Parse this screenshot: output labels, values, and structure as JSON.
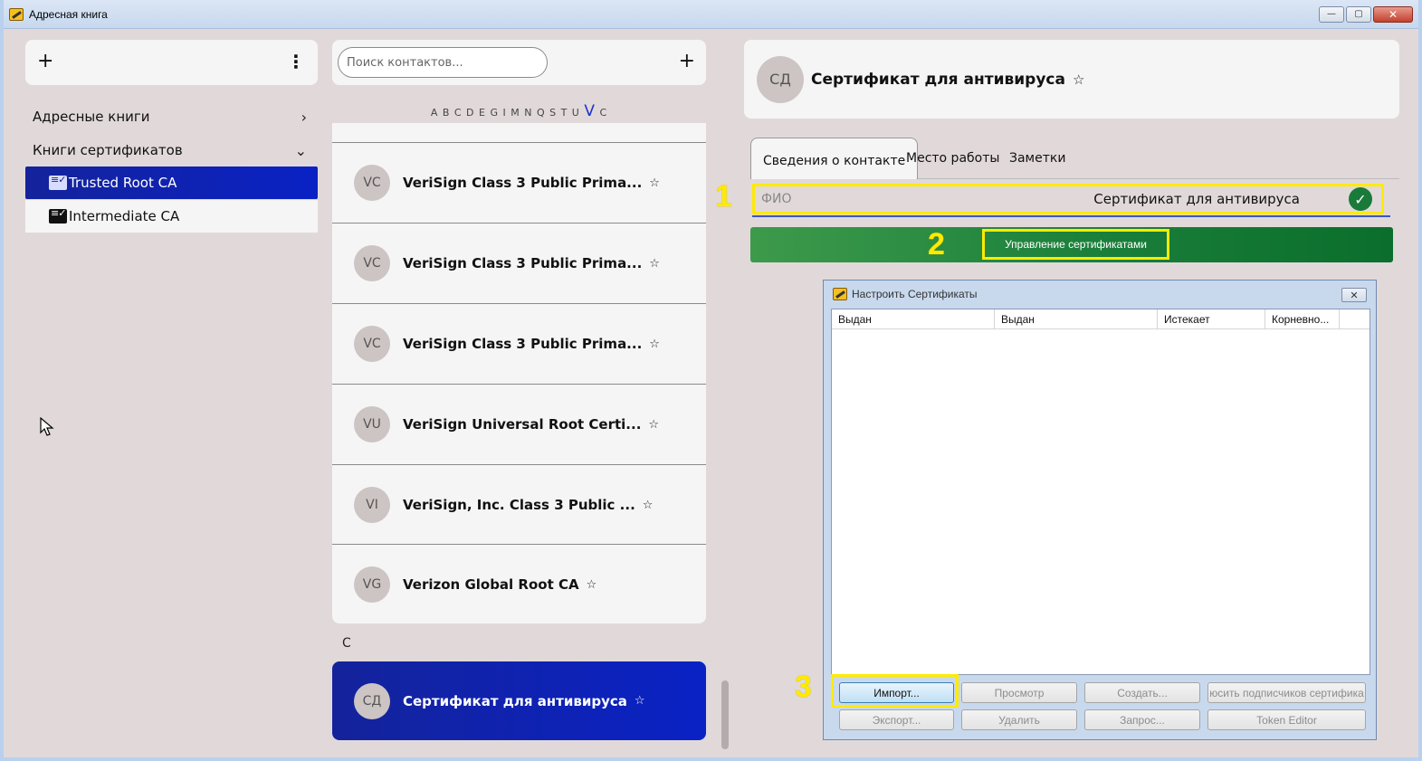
{
  "window": {
    "title": "Адресная книга",
    "min": "—",
    "max": "▢",
    "close": "✕"
  },
  "left": {
    "add": "+",
    "menu": "⋮",
    "nav": [
      {
        "label": "Адресные книги",
        "chevron": "›"
      },
      {
        "label": "Книги сертификатов",
        "chevron": "⌄"
      }
    ],
    "books": [
      {
        "label": "Trusted Root CA",
        "active": true
      },
      {
        "label": "Intermediate CA",
        "active": false
      }
    ]
  },
  "middle": {
    "search_placeholder": "Поиск контактов...",
    "add": "+",
    "alphabet": "A B C D E G I M N Q S T U",
    "alphabet_current": "V",
    "alphabet_after": "C",
    "contacts": [
      {
        "initials": "VC",
        "name": "VeriSign Class 3 Public Prima...",
        "star": "☆"
      },
      {
        "initials": "VC",
        "name": "VeriSign Class 3 Public Prima...",
        "star": "☆"
      },
      {
        "initials": "VC",
        "name": "VeriSign Class 3 Public Prima...",
        "star": "☆"
      },
      {
        "initials": "VU",
        "name": "VeriSign Universal Root Certi...",
        "star": "☆"
      },
      {
        "initials": "VI",
        "name": "VeriSign, Inc. Class 3 Public ...",
        "star": "☆"
      },
      {
        "initials": "VG",
        "name": "Verizon Global Root CA",
        "star": "☆"
      }
    ],
    "section_c": "C",
    "selected": {
      "initials": "СД",
      "name": "Сертификат для антивируса",
      "star": "☆"
    }
  },
  "right": {
    "header": {
      "initials": "СД",
      "title": "Сертификат для антивируса",
      "star": "☆"
    },
    "tabs": [
      "Сведения о контакте",
      "Место работы",
      "Заметки"
    ],
    "fio_label": "ФИО",
    "fio_value": "Сертификат для антивируса",
    "check": "✓",
    "manage_certs": "Управление сертификатами",
    "annotations": [
      "1",
      "2",
      "3"
    ]
  },
  "dialog": {
    "title": "Настроить Сертификаты",
    "close": "✕",
    "columns": [
      "Выдан",
      "Выдан",
      "Истекает",
      "Корневно..."
    ],
    "buttons_row1": [
      "Импорт...",
      "Просмотр",
      "Создать...",
      "юсить подписчиков сертифика"
    ],
    "buttons_row2": [
      "Экспорт...",
      "Удалить",
      "Запрос...",
      "Token Editor"
    ]
  },
  "colors": {
    "accent_blue": "#0a22c5",
    "green_bar": "#1a7f3a",
    "highlight": "#ffea00"
  }
}
